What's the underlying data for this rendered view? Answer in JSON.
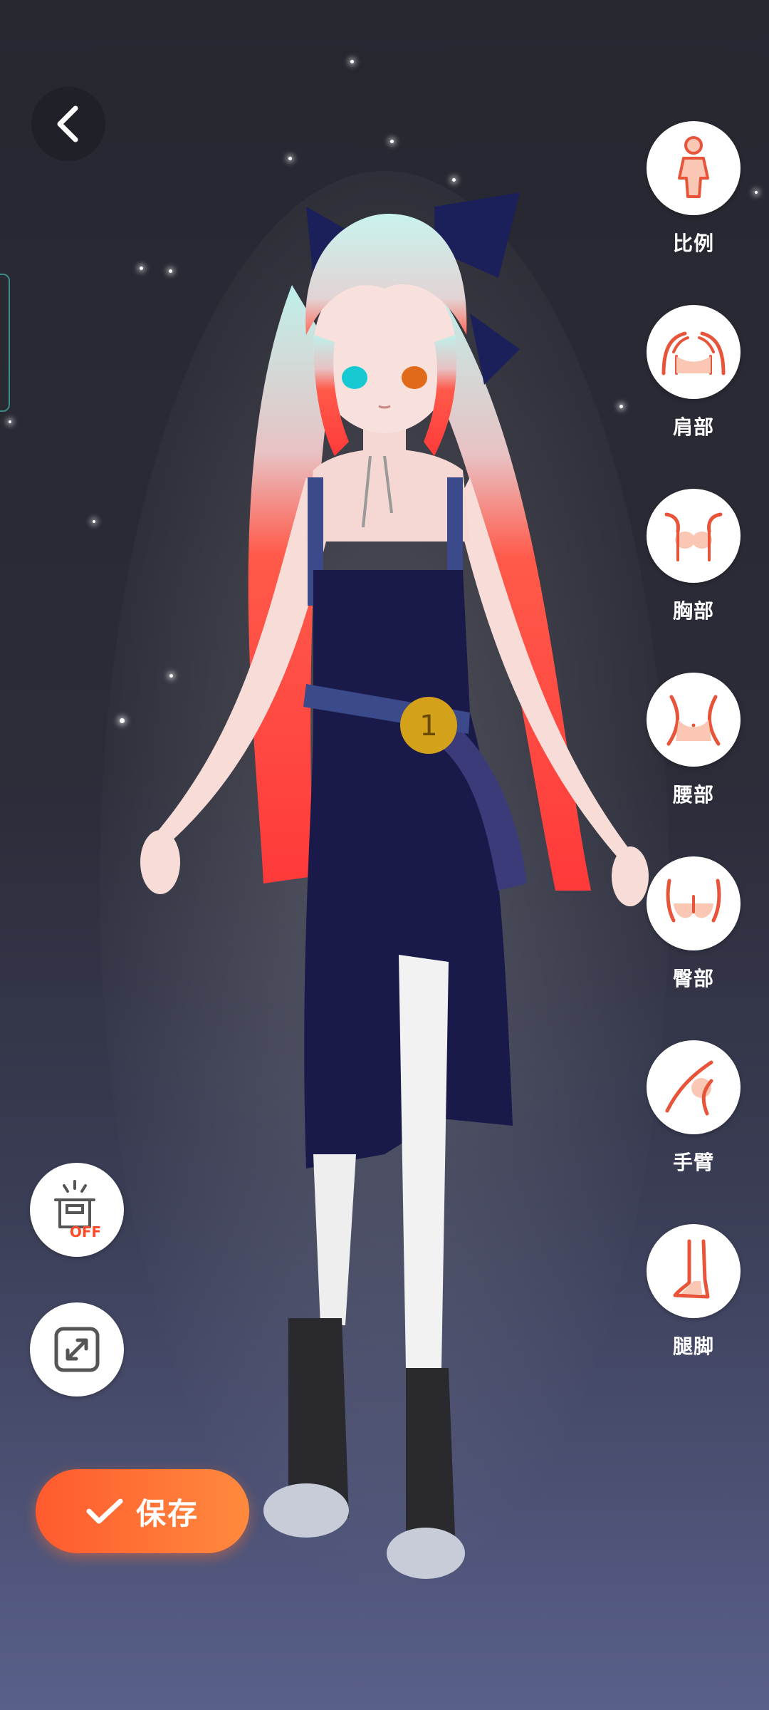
{
  "header": {
    "back_icon": "chevron-left-icon"
  },
  "body_menu": {
    "items": [
      {
        "label": "比例",
        "icon": "proportion-icon"
      },
      {
        "label": "肩部",
        "icon": "shoulder-icon"
      },
      {
        "label": "胸部",
        "icon": "chest-icon"
      },
      {
        "label": "腰部",
        "icon": "waist-icon"
      },
      {
        "label": "臀部",
        "icon": "hip-icon"
      },
      {
        "label": "手臂",
        "icon": "arm-icon"
      },
      {
        "label": "腿脚",
        "icon": "leg-icon"
      }
    ]
  },
  "tools": {
    "outfit_toggle_badge": "OFF",
    "outfit_toggle_icon": "outfit-off-icon",
    "fullscreen_icon": "expand-icon"
  },
  "save": {
    "label": "保存",
    "icon": "check-icon"
  },
  "colors": {
    "accent": "#ff6a34",
    "icon_stroke": "#e8543a",
    "icon_fill": "#f9c7b3"
  }
}
